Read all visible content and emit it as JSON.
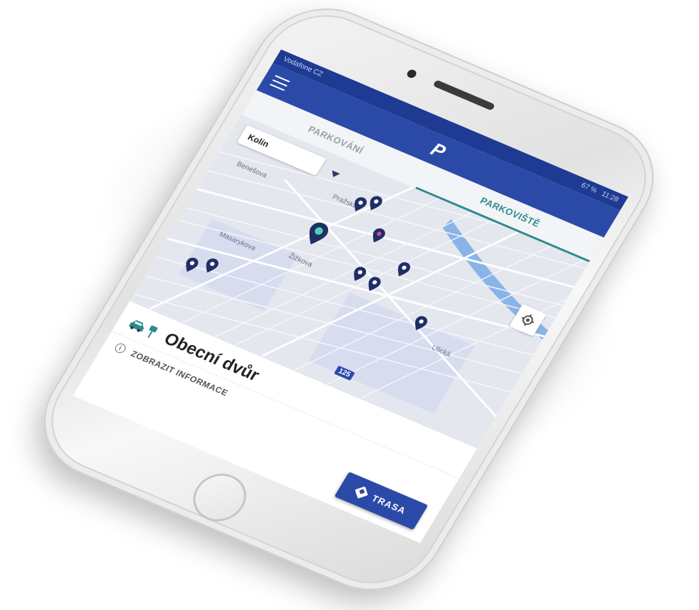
{
  "statusbar": {
    "carrier": "Vodafone CZ",
    "battery": "67 %",
    "time": "11:28"
  },
  "appbar": {
    "menu_icon": "hamburger-menu-icon",
    "logo_letter": "P"
  },
  "tabs": [
    {
      "label": "PARKOVÁNÍ",
      "active": false
    },
    {
      "label": "PARKOVIŠTĚ",
      "active": true
    }
  ],
  "map": {
    "city": "Kolín",
    "road_labels": [
      "Benešova",
      "Pražská",
      "Masarykova",
      "Žižkova",
      "Ulická"
    ],
    "road_number": "125"
  },
  "card": {
    "title": "Obecní dvůr",
    "info_label": "ZOBRAZIT INFORMACE",
    "route_label": "TRASA"
  },
  "colors": {
    "primary": "#2b4aa8",
    "accent": "#2e8a8f",
    "pin": "#1f2f66",
    "pin_selected": "#4fd1b5",
    "pin_pink": "#e24a8b"
  }
}
